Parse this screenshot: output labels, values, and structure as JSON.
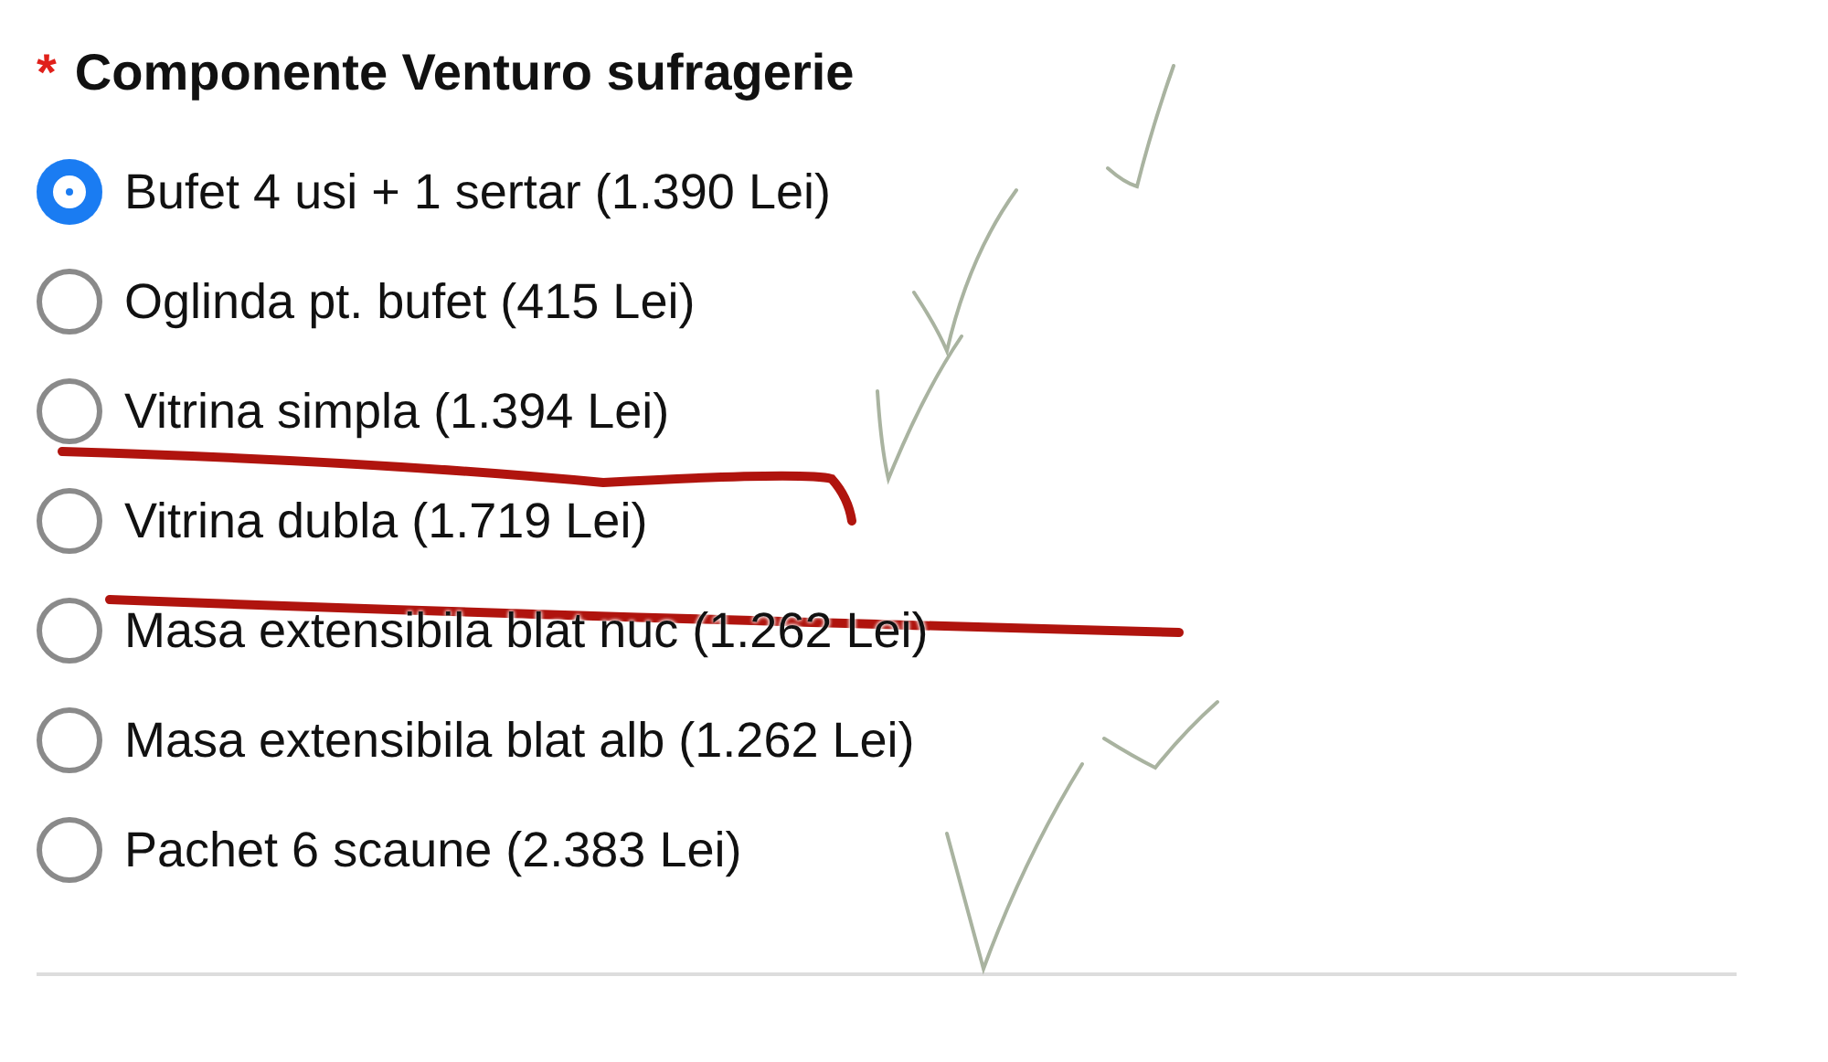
{
  "field": {
    "required_mark": "*",
    "label": "Componente Venturo sufragerie",
    "options": [
      {
        "label": "Bufet 4 usi + 1 sertar (1.390 Lei)",
        "selected": true
      },
      {
        "label": "Oglinda pt. bufet (415 Lei)",
        "selected": false
      },
      {
        "label": "Vitrina simpla (1.394 Lei)",
        "selected": false
      },
      {
        "label": "Vitrina dubla (1.719 Lei)",
        "selected": false
      },
      {
        "label": "Masa extensibila blat nuc (1.262 Lei)",
        "selected": false
      },
      {
        "label": "Masa extensibila blat alb (1.262 Lei)",
        "selected": false
      },
      {
        "label": "Pachet 6 scaune (2.383 Lei)",
        "selected": false
      }
    ]
  }
}
